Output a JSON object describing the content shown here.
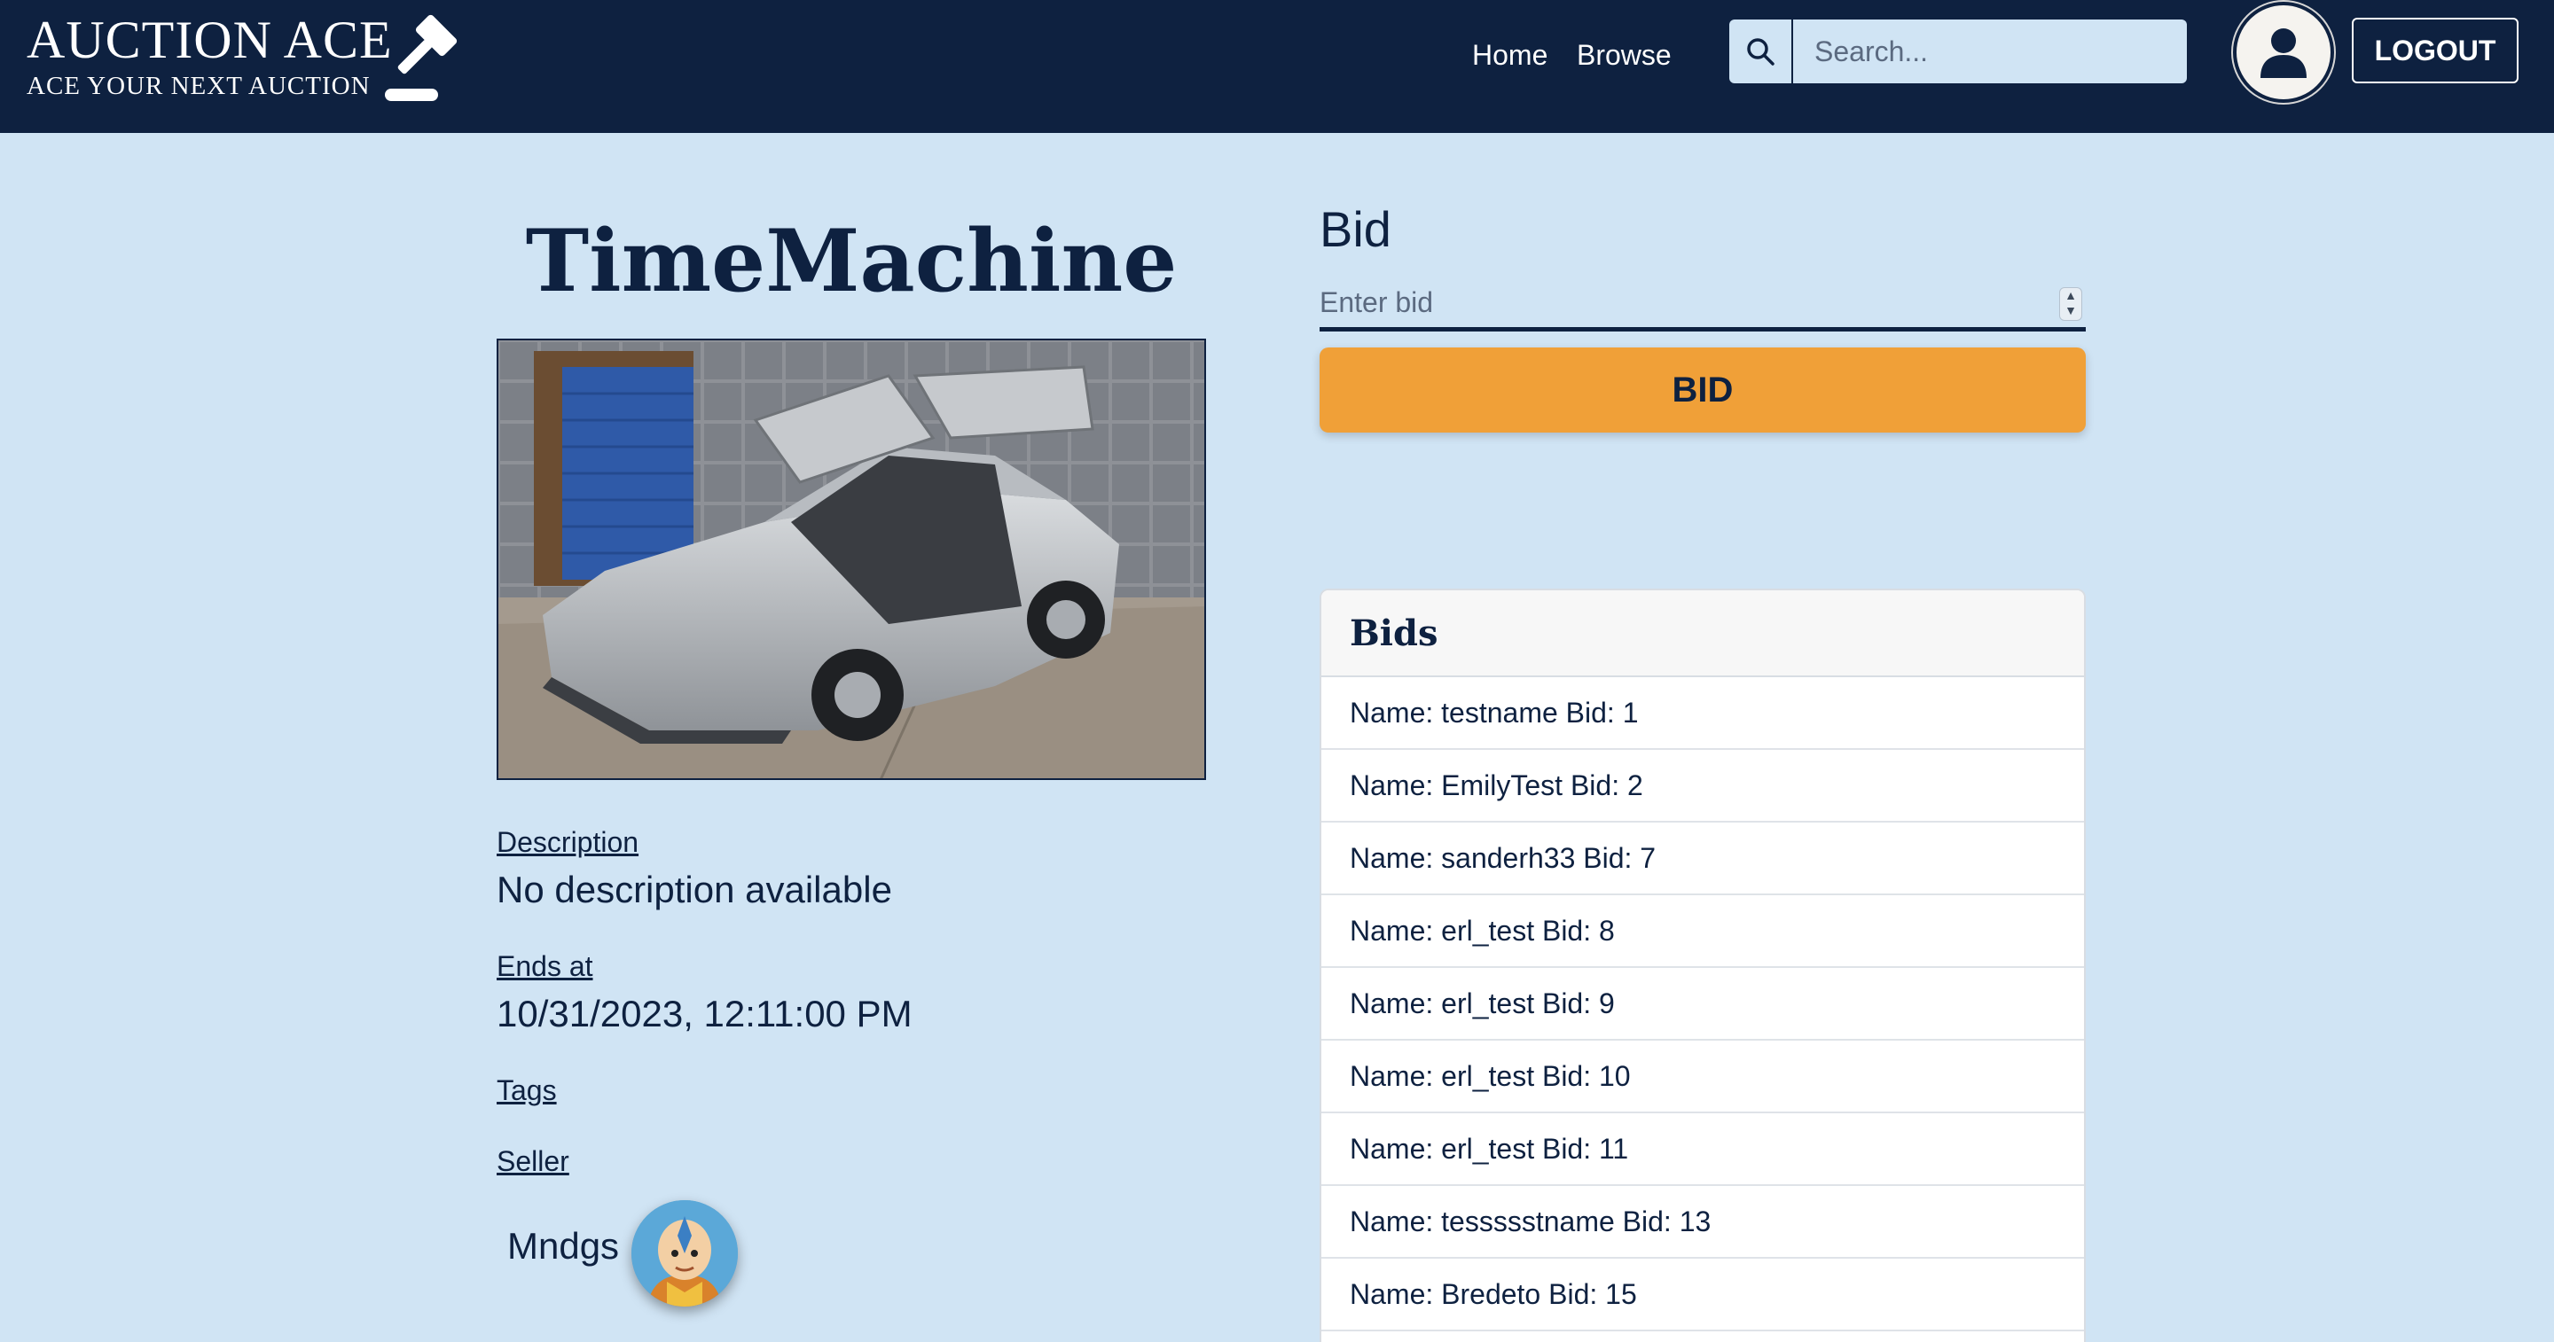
{
  "brand": {
    "title": "AUCTION ACE",
    "tagline": "ACE YOUR NEXT AUCTION"
  },
  "nav": {
    "home": "Home",
    "browse": "Browse"
  },
  "search": {
    "placeholder": "Search..."
  },
  "header": {
    "logout_label": "LOGOUT"
  },
  "item": {
    "title": "TimeMachine",
    "description_label": "Description",
    "description": "No description available",
    "ends_at_label": "Ends at",
    "ends_at": "10/31/2023, 12:11:00 PM",
    "tags_label": "Tags",
    "seller_label": "Seller",
    "seller_name": "Mndgs"
  },
  "bid_form": {
    "heading": "Bid",
    "placeholder": "Enter bid",
    "button_label": "BID"
  },
  "bids": {
    "title": "Bids",
    "rows": [
      "Name: testname Bid: 1",
      "Name: EmilyTest Bid: 2",
      "Name: sanderh33 Bid: 7",
      "Name: erl_test Bid: 8",
      "Name: erl_test Bid: 9",
      "Name: erl_test Bid: 10",
      "Name: erl_test Bid: 11",
      "Name: tessssstname Bid: 13",
      "Name: Bredeto Bid: 15"
    ]
  },
  "colors": {
    "navy": "#0e2140",
    "page_background": "#d0e4f4",
    "accent_orange": "#f0a038"
  },
  "icons": {
    "logo": "gavel-icon",
    "search": "search-icon",
    "profile": "user-icon"
  }
}
